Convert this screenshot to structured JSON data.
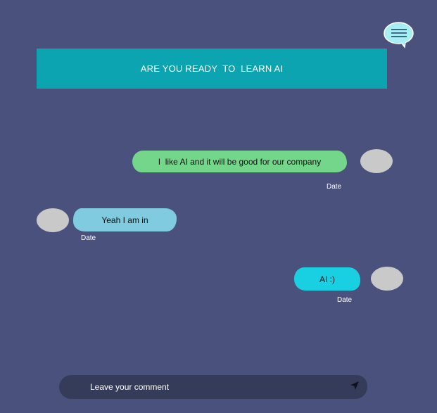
{
  "header": {
    "banner_text": "ARE YOU READY  TO  LEARN AI",
    "menu_icon": "chat-bubble-menu-icon"
  },
  "messages": [
    {
      "side": "right",
      "text": "I  like AI and it will be good for our company",
      "date": "Date"
    },
    {
      "side": "left",
      "text": "Yeah I am in",
      "date": "Date"
    },
    {
      "side": "right",
      "text": "AI :)",
      "date": "Date"
    }
  ],
  "composer": {
    "placeholder": "Leave your comment",
    "value": "",
    "send_icon": "send-arrow-icon"
  },
  "colors": {
    "background": "#4b517d",
    "banner": "#0ba4b0",
    "bubble_green": "#74d68b",
    "bubble_blue": "#80cbdf",
    "bubble_cyan": "#19d0e3",
    "avatar": "#c9c9c9",
    "composer": "#343c5a"
  }
}
